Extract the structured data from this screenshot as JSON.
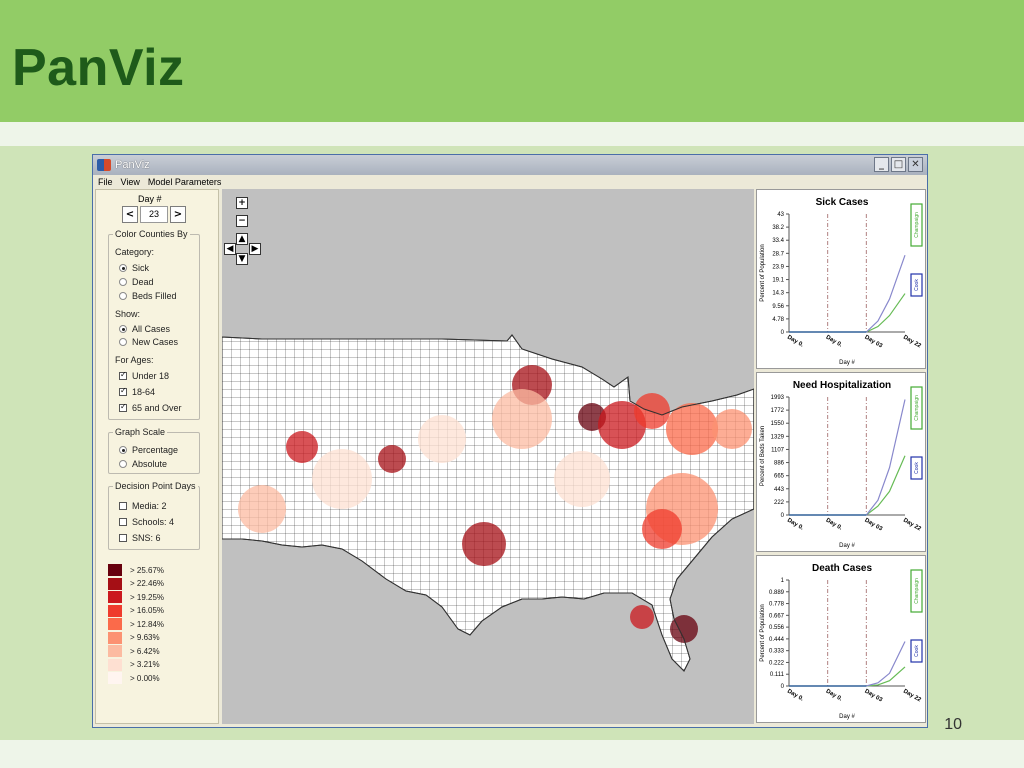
{
  "slide": {
    "title": "PanViz",
    "page_number": "10"
  },
  "window": {
    "title": "PanViz",
    "menu": [
      "File",
      "View",
      "Model Parameters"
    ],
    "controls": {
      "minimize": "_",
      "maximize": "□",
      "close": "✕"
    }
  },
  "panel": {
    "day_label": "Day #",
    "day_value": "23",
    "prev": "<",
    "next": ">",
    "color_counties": {
      "title": "Color Counties By",
      "category_label": "Category:",
      "category_options": [
        "Sick",
        "Dead",
        "Beds Filled"
      ],
      "category_selected": "Sick",
      "show_label": "Show:",
      "show_options": [
        "All Cases",
        "New Cases"
      ],
      "show_selected": "All Cases",
      "ages_label": "For Ages:",
      "ages": [
        "Under 18",
        "18-64",
        "65 and Over"
      ],
      "ages_checked": [
        true,
        true,
        true
      ]
    },
    "graph_scale": {
      "title": "Graph Scale",
      "options": [
        "Percentage",
        "Absolute"
      ],
      "selected": "Percentage"
    },
    "decision_days": {
      "title": "Decision Point Days",
      "items": [
        "Media: 2",
        "Schools: 4",
        "SNS: 6"
      ],
      "checked": [
        false,
        false,
        false
      ]
    },
    "legend": [
      {
        "label": "> 25.67%",
        "color": "#67000d"
      },
      {
        "label": "> 22.46%",
        "color": "#a50f15"
      },
      {
        "label": "> 19.25%",
        "color": "#cb181d"
      },
      {
        "label": "> 16.05%",
        "color": "#ef3b2c"
      },
      {
        "label": "> 12.84%",
        "color": "#fb6a4a"
      },
      {
        "label": "> 9.63%",
        "color": "#fc9272"
      },
      {
        "label": "> 6.42%",
        "color": "#fcbba1"
      },
      {
        "label": "> 3.21%",
        "color": "#fee0d2"
      },
      {
        "label": "> 0.00%",
        "color": "#fff5f0"
      }
    ]
  },
  "map": {
    "nav": {
      "zoom_in": "+",
      "zoom_out": "−",
      "up": "▲",
      "down": "▼",
      "left": "◀",
      "right": "▶"
    },
    "background": "#c0c0c0"
  },
  "chart_data": [
    {
      "type": "line",
      "title": "Sick Cases",
      "ylabel": "Percent of Population",
      "xlabel": "Day #",
      "yticks": [
        "43",
        "38.2",
        "33.4",
        "28.7",
        "23.9",
        "19.1",
        "14.3",
        "9.56",
        "4.78",
        "0"
      ],
      "ylim": [
        0,
        43
      ],
      "xticks": [
        "Day 0.",
        "Day 0.",
        "Day 03",
        "Day 22"
      ],
      "legend": [
        "Champaign",
        "Cook"
      ],
      "series": [
        {
          "name": "Champaign",
          "color": "#66bb55",
          "x": [
            0,
            1,
            2,
            2.3,
            2.6,
            3
          ],
          "y": [
            0,
            0,
            0,
            2,
            6,
            14
          ]
        },
        {
          "name": "Cook",
          "color": "#8888cc",
          "x": [
            0,
            1,
            2,
            2.3,
            2.6,
            3
          ],
          "y": [
            0,
            0,
            0,
            4,
            12,
            28
          ]
        }
      ]
    },
    {
      "type": "line",
      "title": "Need Hospitalization",
      "ylabel": "Percent of Beds Taken",
      "xlabel": "Day #",
      "yticks": [
        "1993",
        "1772",
        "1550",
        "1329",
        "1107",
        "886",
        "665",
        "443",
        "222",
        "0"
      ],
      "ylim": [
        0,
        1993
      ],
      "xticks": [
        "Day 0.",
        "Day 0.",
        "Day 03",
        "Day 22"
      ],
      "legend": [
        "Champaign",
        "Cook"
      ],
      "series": [
        {
          "name": "Champaign",
          "color": "#66bb55",
          "x": [
            0,
            1,
            2,
            2.3,
            2.6,
            3
          ],
          "y": [
            0,
            0,
            0,
            150,
            400,
            1000
          ]
        },
        {
          "name": "Cook",
          "color": "#8888cc",
          "x": [
            0,
            1,
            2,
            2.3,
            2.6,
            3
          ],
          "y": [
            0,
            0,
            0,
            250,
            800,
            1950
          ]
        }
      ]
    },
    {
      "type": "line",
      "title": "Death Cases",
      "ylabel": "Percent of Population",
      "xlabel": "Day #",
      "yticks": [
        "1",
        "0.889",
        "0.778",
        "0.667",
        "0.556",
        "0.444",
        "0.333",
        "0.222",
        "0.111",
        "0"
      ],
      "ylim": [
        0,
        1
      ],
      "xticks": [
        "Day 0.",
        "Day 0.",
        "Day 03",
        "Day 22"
      ],
      "legend": [
        "Champaign",
        "Cook"
      ],
      "series": [
        {
          "name": "Champaign",
          "color": "#66bb55",
          "x": [
            0,
            1,
            2,
            2.3,
            2.6,
            3
          ],
          "y": [
            0,
            0,
            0,
            0.01,
            0.05,
            0.18
          ]
        },
        {
          "name": "Cook",
          "color": "#8888cc",
          "x": [
            0,
            1,
            2,
            2.3,
            2.6,
            3
          ],
          "y": [
            0,
            0,
            0,
            0.03,
            0.12,
            0.42
          ]
        }
      ]
    }
  ]
}
